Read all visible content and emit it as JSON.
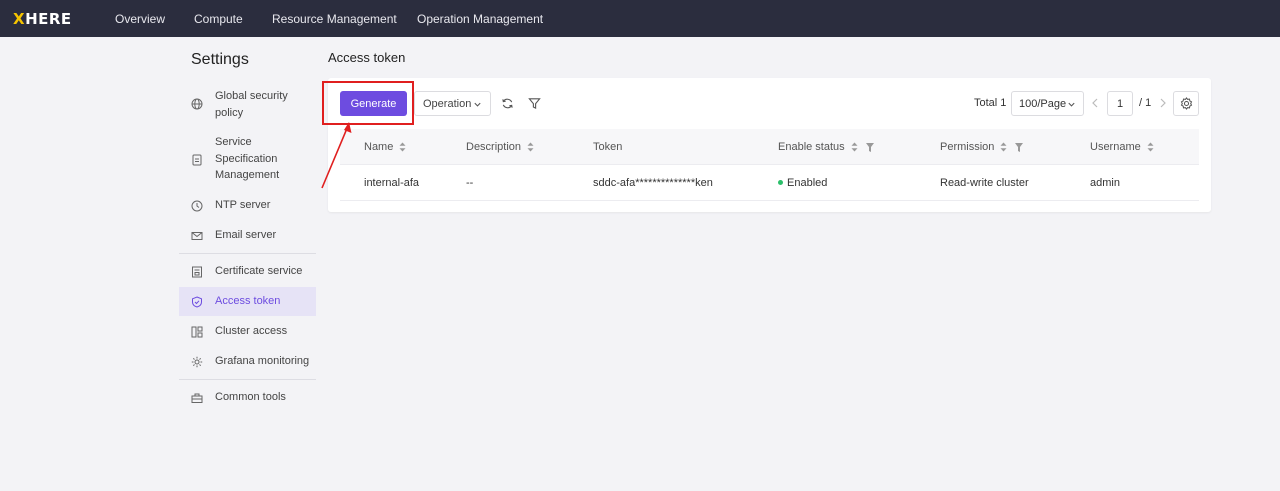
{
  "topbar": {
    "logo_x": "X",
    "logo_rest": "HERE",
    "nav": [
      "Overview",
      "Compute",
      "Resource Management",
      "Operation Management"
    ]
  },
  "sidebar": {
    "title": "Settings",
    "items": [
      {
        "label": "Global security policy",
        "icon": "globe-icon"
      },
      {
        "label": "Service Specification Management",
        "icon": "document-icon"
      },
      {
        "label": "NTP server",
        "icon": "clock-icon"
      },
      {
        "label": "Email server",
        "icon": "mail-icon"
      },
      {
        "label": "Certificate service",
        "icon": "certificate-icon"
      },
      {
        "label": "Access token",
        "icon": "shield-icon"
      },
      {
        "label": "Cluster access",
        "icon": "grid-icon"
      },
      {
        "label": "Grafana monitoring",
        "icon": "gear-icon"
      },
      {
        "label": "Common tools",
        "icon": "toolbox-icon"
      }
    ]
  },
  "main": {
    "title": "Access token",
    "toolbar": {
      "generate_label": "Generate",
      "operation_label": "Operation"
    },
    "pagination": {
      "total_text": "Total 1",
      "page_size": "100/Page",
      "current_page": "1",
      "total_pages": "/ 1"
    },
    "table": {
      "columns": [
        "Name",
        "Description",
        "Token",
        "Enable status",
        "Permission",
        "Username"
      ],
      "rows": [
        {
          "name": "internal-afa",
          "description": "--",
          "token": "sddc-afa**************ken",
          "status": "Enabled",
          "permission": "Read-write cluster",
          "username": "admin"
        }
      ]
    }
  },
  "colors": {
    "accent": "#6d4ce0",
    "topbar": "#2b2d3e",
    "status_enabled": "#2bbf6a",
    "annotation": "#e01f1f"
  }
}
